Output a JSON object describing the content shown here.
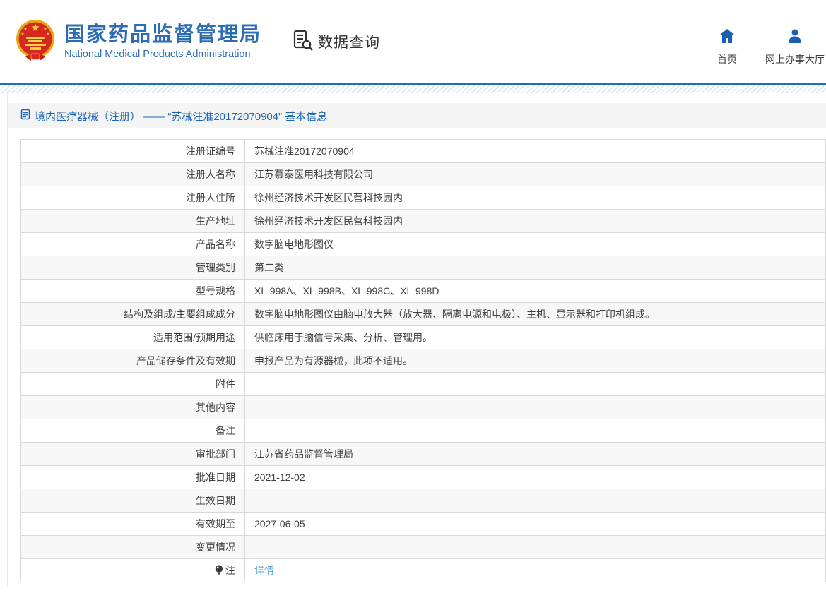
{
  "header": {
    "org_name_cn": "国家药品监督管理局",
    "org_name_en": "National Medical Products Administration",
    "section_title": "数据查询",
    "nav": [
      {
        "label": "首页",
        "icon": "home-icon"
      },
      {
        "label": "网上办事大厅",
        "icon": "user-icon"
      }
    ]
  },
  "breadcrumb": {
    "title": "境内医疗器械（注册） —— “苏械注准20172070904” 基本信息"
  },
  "table": {
    "rows": [
      {
        "label": "注册证编号",
        "value": "苏械注准20172070904"
      },
      {
        "label": "注册人名称",
        "value": "江苏慕泰医用科技有限公司"
      },
      {
        "label": "注册人住所",
        "value": "徐州经济技术开发区民营科技园内"
      },
      {
        "label": "生产地址",
        "value": "徐州经济技术开发区民营科技园内"
      },
      {
        "label": "产品名称",
        "value": "数字脑电地形图仪"
      },
      {
        "label": "管理类别",
        "value": "第二类"
      },
      {
        "label": "型号规格",
        "value": "XL-998A、XL-998B、XL-998C、XL-998D"
      },
      {
        "label": "结构及组成/主要组成成分",
        "value": "数字脑电地形图仪由脑电放大器（放大器、隔离电源和电极）、主机、显示器和打印机组成。"
      },
      {
        "label": "适用范围/预期用途",
        "value": "供临床用于脑信号采集、分析、管理用。"
      },
      {
        "label": "产品储存条件及有效期",
        "value": "申报产品为有源器械，此项不适用。"
      },
      {
        "label": "附件",
        "value": ""
      },
      {
        "label": "其他内容",
        "value": ""
      },
      {
        "label": "备注",
        "value": ""
      },
      {
        "label": "审批部门",
        "value": "江苏省药品监督管理局"
      },
      {
        "label": "批准日期",
        "value": "2021-12-02"
      },
      {
        "label": "生效日期",
        "value": ""
      },
      {
        "label": "有效期至",
        "value": "2027-06-05"
      },
      {
        "label": "变更情况",
        "value": ""
      },
      {
        "label": "注",
        "value": "详情",
        "value_is_link": true,
        "label_icon": "bulb-icon"
      }
    ]
  },
  "colors": {
    "accent_blue": "#2c6cb5",
    "separator_blue": "#1d70b8",
    "link_blue": "#4d9cd8",
    "row_alt_gray": "#f7f7f7",
    "border_gray": "#d8d8d8"
  }
}
